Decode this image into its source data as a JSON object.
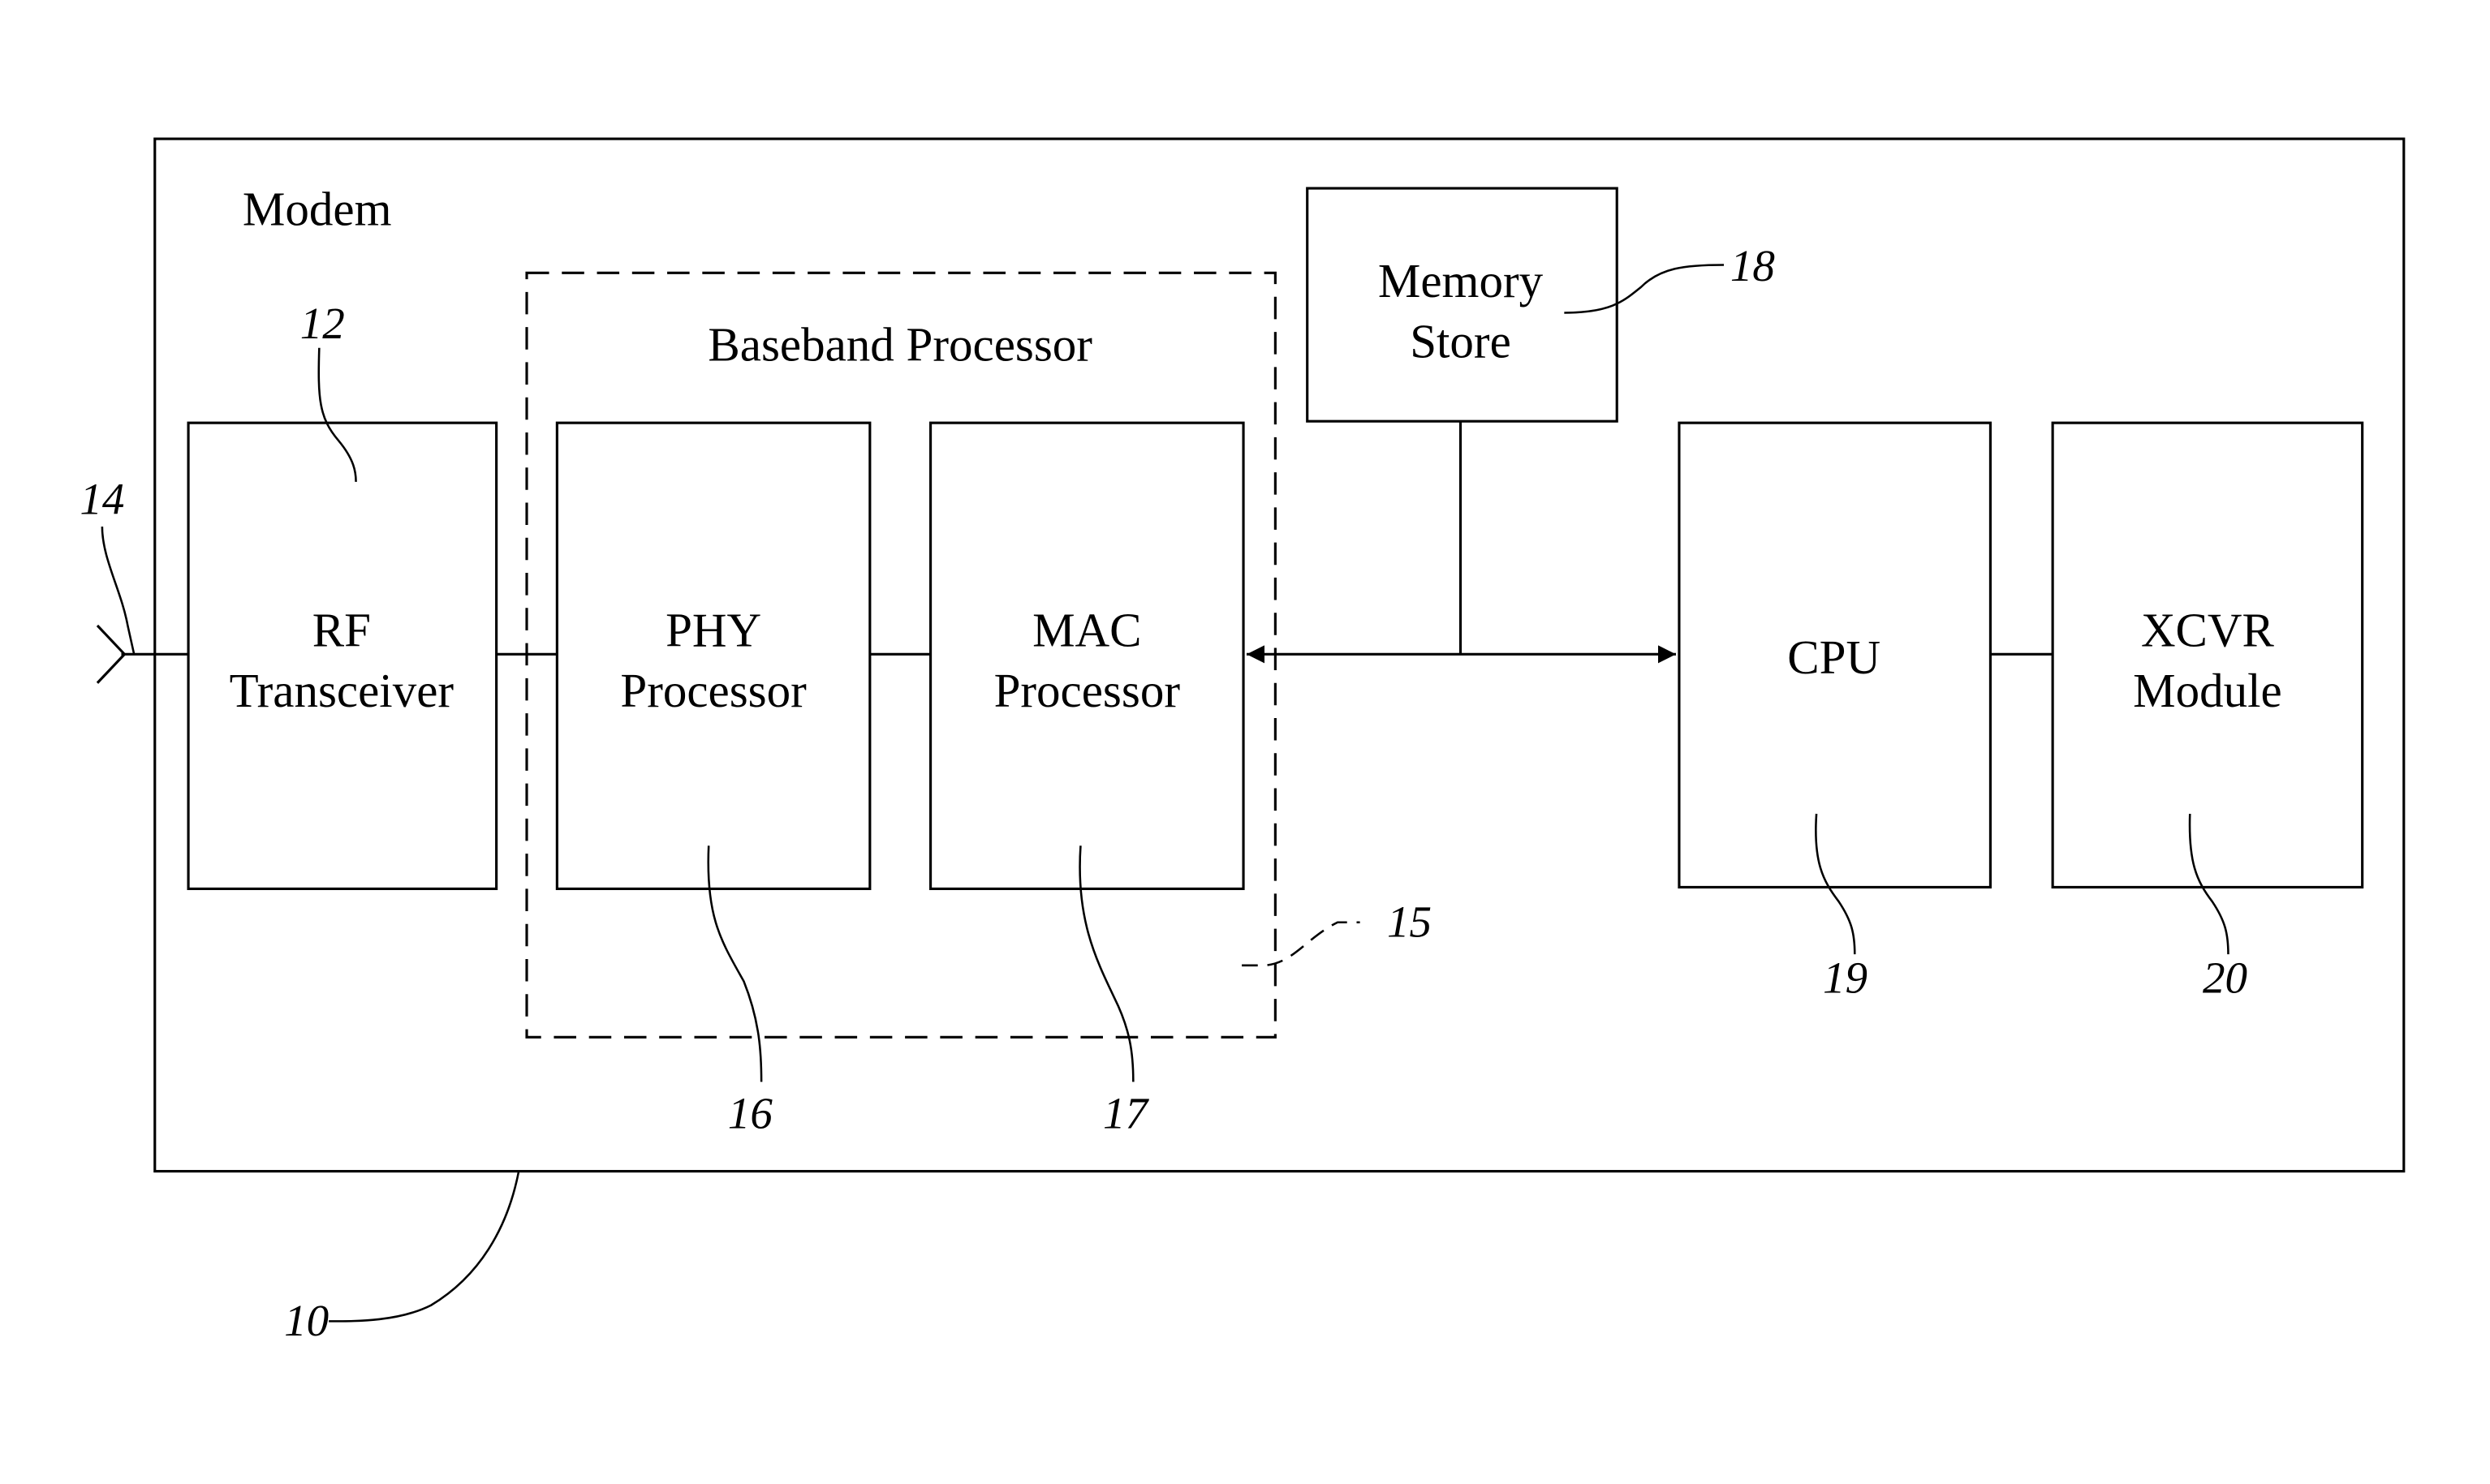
{
  "diagram": {
    "container_label": "Modem",
    "container_ref": "10",
    "antenna_ref": "14",
    "baseband": {
      "label": "Baseband Processor",
      "ref": "15"
    },
    "blocks": {
      "rf": {
        "line1": "RF",
        "line2": "Transceiver",
        "ref": "12"
      },
      "phy": {
        "line1": "PHY",
        "line2": "Processor",
        "ref": "16"
      },
      "mac": {
        "line1": "MAC",
        "line2": "Processor",
        "ref": "17"
      },
      "memory": {
        "line1": "Memory",
        "line2": "Store",
        "ref": "18"
      },
      "cpu": {
        "line1": "CPU",
        "ref": "19"
      },
      "xcvr": {
        "line1": "XCVR",
        "line2": "Module",
        "ref": "20"
      }
    }
  }
}
